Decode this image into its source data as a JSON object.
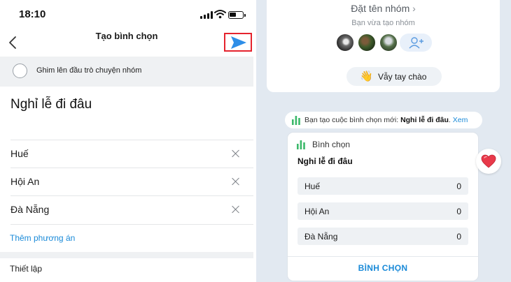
{
  "status_bar": {
    "time": "18:10"
  },
  "create_poll": {
    "title": "Tạo bình chọn",
    "pin_label": "Ghim lên đầu trò chuyện nhóm",
    "question": "Nghỉ lễ đi đâu",
    "options": [
      {
        "label": "Huế"
      },
      {
        "label": "Hội An"
      },
      {
        "label": "Đà Nẵng"
      }
    ],
    "add_option_label": "Thêm phương án",
    "settings_label": "Thiết lập"
  },
  "chat": {
    "group": {
      "name_prompt": "Đặt tên nhóm",
      "subtitle": "Bạn vừa tạo nhóm",
      "wave_button": "Vẫy tay chào",
      "wave_emoji": "👋"
    },
    "notice": {
      "prefix": "Bạn tạo cuộc bình chọn mới: ",
      "poll_name": "Nghỉ lễ đi đâu",
      "suffix": ". ",
      "link": "Xem"
    },
    "poll": {
      "label": "Bình chọn",
      "question": "Nghỉ lễ đi đâu",
      "options": [
        {
          "label": "Huế",
          "count": "0"
        },
        {
          "label": "Hội An",
          "count": "0"
        },
        {
          "label": "Đà Nẵng",
          "count": "0"
        }
      ],
      "vote_button": "BÌNH CHỌN"
    }
  },
  "colors": {
    "accent_blue": "#1a8ad8",
    "send_arrow": "#2e8ee8",
    "highlight_red": "#e5232d",
    "chat_background": "#e2e9f1",
    "poll_icon_green": "#3cb96a"
  }
}
